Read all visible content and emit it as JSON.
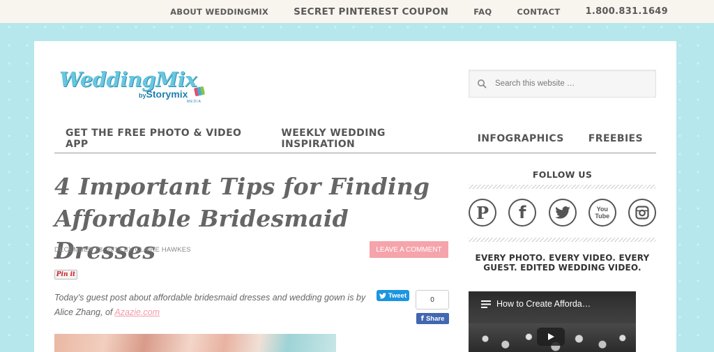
{
  "topnav": {
    "about": "ABOUT WEDDINGMIX",
    "coupon": "SECRET PINTEREST COUPON",
    "faq": "FAQ",
    "contact": "CONTACT",
    "phone": "1.800.831.1649"
  },
  "logo": {
    "name": "WeddingMix",
    "by": "by",
    "brand": "Storymix",
    "tag": "MEDIA"
  },
  "search": {
    "placeholder": "Search this website …"
  },
  "mainnav": [
    "GET THE FREE PHOTO & VIDEO APP",
    "WEEKLY WEDDING INSPIRATION",
    "INFOGRAPHICS",
    "FREEBIES"
  ],
  "article": {
    "title": "4 Important Tips for Finding Affordable Bridesmaid Dresses",
    "date": "DECEMBER 28, 2015",
    "by": "BY",
    "author": "CLAIRE HAWKES",
    "leave_comment": "LEAVE A COMMENT",
    "pinit": "Pin it",
    "intro": "Today’s guest post about affordable bridesmaid dresses and wedding gown is by Alice Zhang, of",
    "link": "Azazie.com",
    "tweet": "Tweet",
    "share_count": "0",
    "share": "Share"
  },
  "sidebar": {
    "follow_title": "FOLLOW US",
    "social_icons": [
      "pinterest-icon",
      "facebook-icon",
      "twitter-icon",
      "youtube-icon",
      "instagram-icon"
    ],
    "youtube_text": "You Tube",
    "promo": "EVERY PHOTO. EVERY VIDEO. EVERY GUEST. EDITED WEDDING VIDEO.",
    "video_title": "How to Create Afforda…"
  },
  "colors": {
    "background": "#b6e7ec",
    "topbar": "#f8f5ef",
    "accent_pink": "#f5a4ab",
    "logo_blue": "#69c6df",
    "tweet_blue": "#1b95e0",
    "facebook_blue": "#4267b2"
  }
}
